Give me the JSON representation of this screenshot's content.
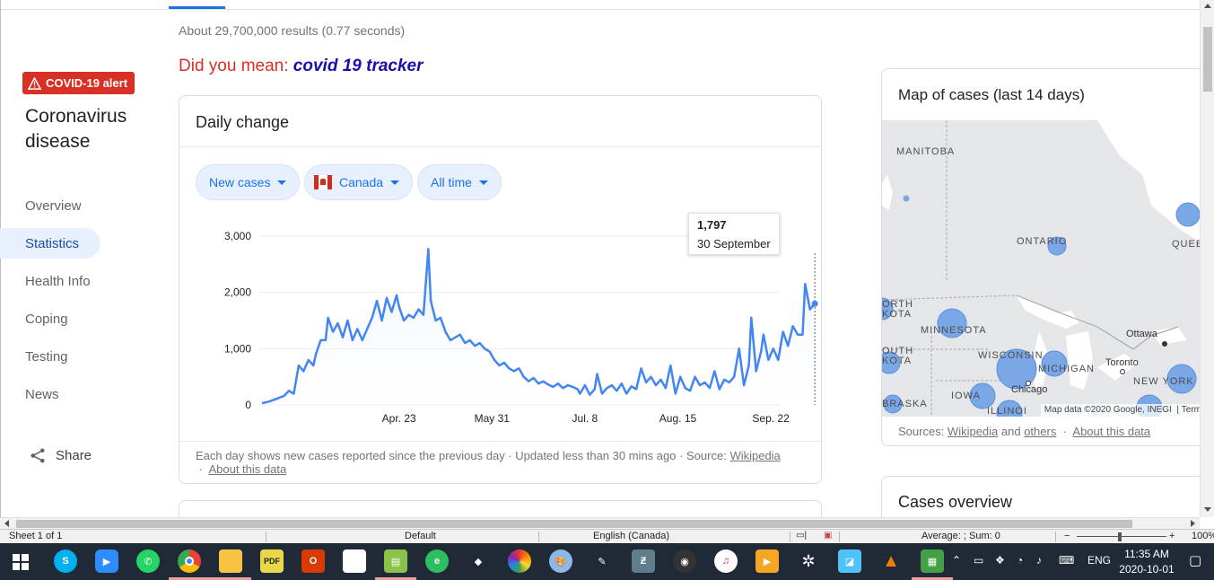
{
  "results": {
    "count_text": "About 29,700,000 results (0.77 seconds)"
  },
  "did_you_mean": {
    "prefix": "Did you mean: ",
    "suggestion": "covid 19 tracker"
  },
  "side": {
    "alert": "COVID-19 alert",
    "title": "Coronavirus disease",
    "nav": [
      "Overview",
      "Statistics",
      "Health Info",
      "Coping",
      "Testing",
      "News"
    ],
    "active": "Statistics",
    "share": "Share"
  },
  "daily_card": {
    "title": "Daily change",
    "chips": {
      "metric": "New cases",
      "region": "Canada",
      "range": "All time"
    },
    "tooltip": {
      "value": "1,797",
      "date": "30 September"
    },
    "footer_text": "Each day shows new cases reported since the previous day · Updated less than 30 mins ago · Source: ",
    "footer_source": "Wikipedia",
    "footer_about": "About this data"
  },
  "chart_data": {
    "type": "area",
    "x_tick_labels": [
      "Apr. 23",
      "May 31",
      "Jul. 8",
      "Aug. 15",
      "Sep. 22"
    ],
    "y_tick_labels": [
      "0",
      "1,000",
      "2,000",
      "3,000"
    ],
    "ylim": [
      0,
      3000
    ],
    "grid": true,
    "color": "#4285f4",
    "x_range_days": [
      0,
      212
    ],
    "series": [
      {
        "points": [
          [
            0,
            30
          ],
          [
            3,
            60
          ],
          [
            6,
            110
          ],
          [
            9,
            160
          ],
          [
            11,
            250
          ],
          [
            13,
            200
          ],
          [
            15,
            700
          ],
          [
            17,
            600
          ],
          [
            19,
            800
          ],
          [
            21,
            700
          ],
          [
            22,
            900
          ],
          [
            24,
            1150
          ],
          [
            26,
            1150
          ],
          [
            27,
            1550
          ],
          [
            29,
            1300
          ],
          [
            31,
            1450
          ],
          [
            33,
            1200
          ],
          [
            35,
            1500
          ],
          [
            37,
            1150
          ],
          [
            39,
            1350
          ],
          [
            41,
            1150
          ],
          [
            43,
            1350
          ],
          [
            45,
            1550
          ],
          [
            47,
            1850
          ],
          [
            49,
            1500
          ],
          [
            51,
            1900
          ],
          [
            53,
            1650
          ],
          [
            55,
            1950
          ],
          [
            56,
            1750
          ],
          [
            58,
            1500
          ],
          [
            60,
            1600
          ],
          [
            62,
            1550
          ],
          [
            64,
            1700
          ],
          [
            66,
            1600
          ],
          [
            68,
            2770
          ],
          [
            69,
            1850
          ],
          [
            71,
            1500
          ],
          [
            73,
            1550
          ],
          [
            75,
            1300
          ],
          [
            77,
            1150
          ],
          [
            79,
            1200
          ],
          [
            81,
            1250
          ],
          [
            83,
            1100
          ],
          [
            85,
            1150
          ],
          [
            87,
            1050
          ],
          [
            89,
            1100
          ],
          [
            91,
            1000
          ],
          [
            93,
            950
          ],
          [
            95,
            800
          ],
          [
            97,
            700
          ],
          [
            99,
            750
          ],
          [
            101,
            650
          ],
          [
            103,
            600
          ],
          [
            105,
            650
          ],
          [
            107,
            500
          ],
          [
            109,
            420
          ],
          [
            111,
            480
          ],
          [
            113,
            380
          ],
          [
            115,
            420
          ],
          [
            117,
            360
          ],
          [
            119,
            320
          ],
          [
            121,
            380
          ],
          [
            123,
            300
          ],
          [
            125,
            350
          ],
          [
            127,
            320
          ],
          [
            129,
            280
          ],
          [
            130,
            200
          ],
          [
            132,
            350
          ],
          [
            134,
            180
          ],
          [
            136,
            280
          ],
          [
            137,
            550
          ],
          [
            139,
            200
          ],
          [
            141,
            300
          ],
          [
            143,
            350
          ],
          [
            145,
            250
          ],
          [
            147,
            380
          ],
          [
            149,
            200
          ],
          [
            151,
            330
          ],
          [
            153,
            280
          ],
          [
            155,
            650
          ],
          [
            157,
            400
          ],
          [
            159,
            500
          ],
          [
            161,
            350
          ],
          [
            163,
            450
          ],
          [
            165,
            300
          ],
          [
            167,
            700
          ],
          [
            169,
            200
          ],
          [
            171,
            500
          ],
          [
            173,
            300
          ],
          [
            175,
            250
          ],
          [
            177,
            500
          ],
          [
            179,
            350
          ],
          [
            181,
            400
          ],
          [
            183,
            300
          ],
          [
            185,
            600
          ],
          [
            187,
            280
          ],
          [
            189,
            450
          ],
          [
            191,
            400
          ],
          [
            193,
            500
          ],
          [
            195,
            1000
          ],
          [
            197,
            350
          ],
          [
            199,
            700
          ],
          [
            200,
            1550
          ],
          [
            202,
            600
          ],
          [
            204,
            950
          ],
          [
            205,
            1250
          ],
          [
            207,
            800
          ],
          [
            209,
            1000
          ],
          [
            211,
            800
          ],
          [
            213,
            1300
          ],
          [
            215,
            1050
          ],
          [
            217,
            1400
          ],
          [
            219,
            1250
          ],
          [
            221,
            1250
          ],
          [
            222,
            2150
          ],
          [
            224,
            1700
          ],
          [
            226,
            1800
          ]
        ]
      }
    ]
  },
  "map_card": {
    "title": "Map of cases (last 14 days)",
    "labels": [
      "MANITOBA",
      "ONTARIO",
      "QUEB",
      "ORTH KOTA",
      "MINNESOTA",
      "OUTH KOTA",
      "WISCONSIN",
      "MICHIGAN",
      "IOWA",
      "BRASKA",
      "ILLINOI",
      "NEW YORK"
    ],
    "cities": [
      "Ottawa",
      "Toronto",
      "Chicago"
    ],
    "attribution": "Map data ©2020 Google, INEGI",
    "terms": "Term",
    "sources_prefix": "Sources: ",
    "source1": "Wikipedia",
    "and": " and ",
    "source2": "others",
    "about": "About this data"
  },
  "cases_card": {
    "title": "Cases overview"
  },
  "statusbar": {
    "sheet": "Sheet 1 of 1",
    "style": "Default",
    "language": "English (Canada)",
    "summary": "Average: ; Sum: 0",
    "zoom": "100%"
  },
  "taskbar": {
    "lang": "ENG",
    "time": "11:35 AM",
    "date": "2020-10-01"
  }
}
